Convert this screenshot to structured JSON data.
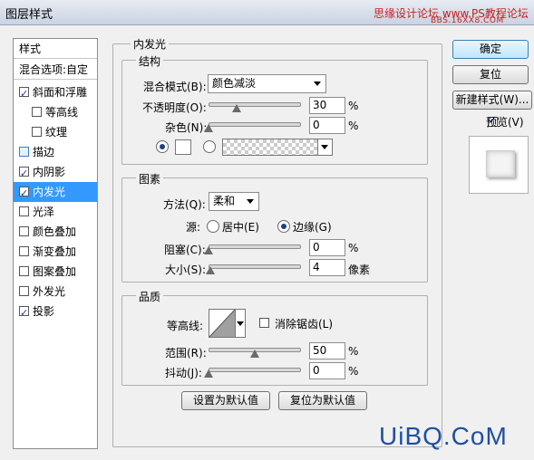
{
  "window": {
    "title": "图层样式",
    "watermark": "思缘设计论坛 www.PS教程论坛",
    "watermark_sub": "BBS.16XX8.COM"
  },
  "style_list": {
    "header": "样式",
    "blend_options": "混合选项:自定",
    "items": [
      {
        "label": "斜面和浮雕",
        "checked": true
      },
      {
        "label": "等高线",
        "checked": false
      },
      {
        "label": "纹理",
        "checked": false
      },
      {
        "label": "描边",
        "checked": false
      },
      {
        "label": "内阴影",
        "checked": true
      },
      {
        "label": "内发光",
        "checked": true,
        "selected": true
      },
      {
        "label": "光泽",
        "checked": false
      },
      {
        "label": "颜色叠加",
        "checked": false
      },
      {
        "label": "渐变叠加",
        "checked": false
      },
      {
        "label": "图案叠加",
        "checked": false
      },
      {
        "label": "外发光",
        "checked": false
      },
      {
        "label": "投影",
        "checked": true
      }
    ]
  },
  "inner_glow": {
    "section_title": "内发光",
    "structure": {
      "title": "结构",
      "blend_mode_label": "混合模式(B):",
      "blend_mode_value": "颜色减淡",
      "opacity_label": "不透明度(O):",
      "opacity_value": "30",
      "opacity_unit": "%",
      "opacity_level": 0.3,
      "noise_label": "杂色(N):",
      "noise_value": "0",
      "noise_unit": "%",
      "noise_level": 0.0
    },
    "elements": {
      "title": "图素",
      "method_label": "方法(Q):",
      "method_value": "柔和",
      "source_label": "源:",
      "source_center": "居中(E)",
      "source_edge": "边缘(G)",
      "choke_label": "阻塞(C):",
      "choke_value": "0",
      "choke_unit": "%",
      "choke_level": 0.0,
      "size_label": "大小(S):",
      "size_value": "4",
      "size_unit": "像素",
      "size_level": 0.016
    },
    "quality": {
      "title": "品质",
      "contour_label": "等高线:",
      "antialias_label": "消除锯齿(L)",
      "range_label": "范围(R):",
      "range_value": "50",
      "range_unit": "%",
      "range_level": 0.5,
      "jitter_label": "抖动(J):",
      "jitter_value": "0",
      "jitter_unit": "%",
      "jitter_level": 0.0
    },
    "set_default": "设置为默认值",
    "reset_default": "复位为默认值"
  },
  "actions": {
    "ok": "确定",
    "reset": "复位",
    "new_style": "新建样式(W)...",
    "preview_label": "预览(V)",
    "preview_checked": true
  },
  "brand": "UiBQ.CoM"
}
